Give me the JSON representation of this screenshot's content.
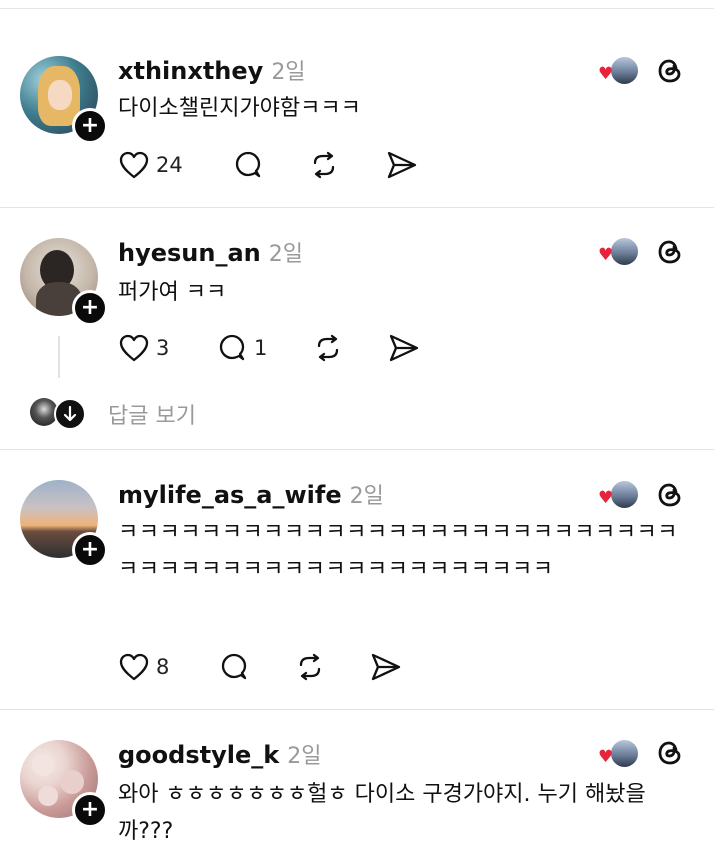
{
  "posts": [
    {
      "username": "xthinxthey",
      "time": "2일",
      "text": "다이소챌린지가야함ㅋㅋㅋ",
      "likes": "24",
      "comments": "",
      "avatar_colors": [
        "#3e7d8f",
        "#e7c27a",
        "#f6d9c2"
      ]
    },
    {
      "username": "hyesun_an",
      "time": "2일",
      "text": "퍼가여 ㅋㅋ",
      "likes": "3",
      "comments": "1",
      "avatar_colors": [
        "#8a7d70",
        "#2b2523",
        "#d8d2cb"
      ]
    },
    {
      "username": "mylife_as_a_wife",
      "time": "2일",
      "text": "ㅋㅋㅋㅋㅋㅋㅋㅋㅋㅋㅋㅋㅋㅋㅋㅋㅋㅋㅋㅋㅋㅋㅋㅋㅋㅋㅋㅋㅋㅋㅋㅋㅋㅋㅋㅋㅋㅋㅋㅋㅋㅋㅋㅋㅋㅋㅋㅋ",
      "likes": "8",
      "comments": "",
      "avatar_colors": [
        "#9fb1c9",
        "#f0b27a",
        "#2d2e33"
      ]
    },
    {
      "username": "goodstyle_k",
      "time": "2일",
      "text": "와아 ㅎㅎㅎㅎㅎㅎㅎ헐ㅎ 다이소 구경가야지. 누기 해놨을까???",
      "likes": "",
      "comments": "",
      "avatar_colors": [
        "#e9d3cf",
        "#c99a98",
        "#f6ece8"
      ]
    }
  ],
  "view_replies": "답글 보기",
  "icons": {
    "like": "heart-outline-icon",
    "comment": "comment-bubble-icon",
    "repost": "repost-icon",
    "share": "send-icon",
    "threads": "threads-logo-icon",
    "follow": "plus-icon"
  }
}
